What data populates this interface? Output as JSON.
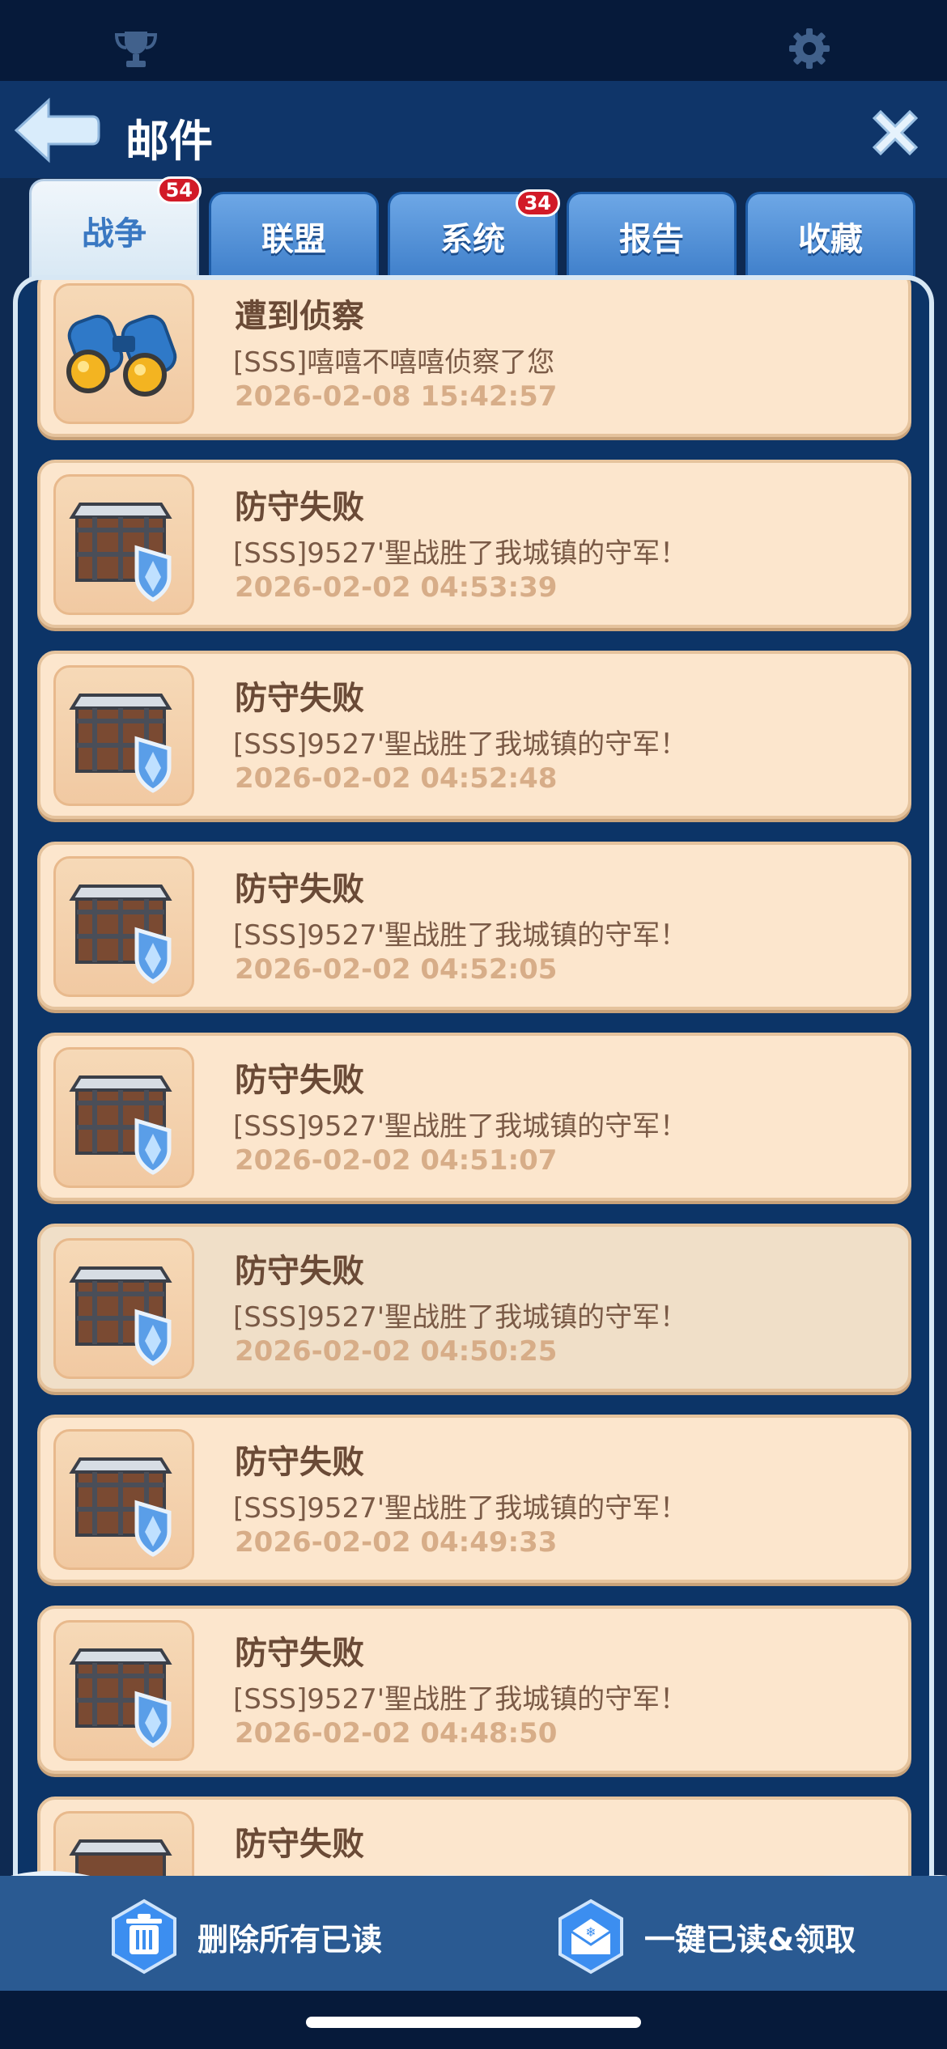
{
  "header": {
    "title": "邮件"
  },
  "tabs": [
    {
      "label": "战争",
      "badge": "54",
      "active": true
    },
    {
      "label": "联盟",
      "badge": "",
      "active": false
    },
    {
      "label": "系统",
      "badge": "34",
      "active": false
    },
    {
      "label": "报告",
      "badge": "",
      "active": false
    },
    {
      "label": "收藏",
      "badge": "",
      "active": false
    }
  ],
  "mails": [
    {
      "subject": "遭到侦察",
      "body": "[SSS]嘻嘻不嘻嘻侦察了您",
      "time": "2026-02-08 15:42:57",
      "icon": "binoculars-icon"
    },
    {
      "subject": "防守失败",
      "body": "[SSS]9527'聖战胜了我城镇的守军！",
      "time": "2026-02-02 04:53:39",
      "icon": "fortress-shield-icon"
    },
    {
      "subject": "防守失败",
      "body": "[SSS]9527'聖战胜了我城镇的守军！",
      "time": "2026-02-02 04:52:48",
      "icon": "fortress-shield-icon"
    },
    {
      "subject": "防守失败",
      "body": "[SSS]9527'聖战胜了我城镇的守军！",
      "time": "2026-02-02 04:52:05",
      "icon": "fortress-shield-icon"
    },
    {
      "subject": "防守失败",
      "body": "[SSS]9527'聖战胜了我城镇的守军！",
      "time": "2026-02-02 04:51:07",
      "icon": "fortress-shield-icon"
    },
    {
      "subject": "防守失败",
      "body": "[SSS]9527'聖战胜了我城镇的守军！",
      "time": "2026-02-02 04:50:25",
      "icon": "fortress-shield-icon"
    },
    {
      "subject": "防守失败",
      "body": "[SSS]9527'聖战胜了我城镇的守军！",
      "time": "2026-02-02 04:49:33",
      "icon": "fortress-shield-icon"
    },
    {
      "subject": "防守失败",
      "body": "[SSS]9527'聖战胜了我城镇的守军！",
      "time": "2026-02-02 04:48:50",
      "icon": "fortress-shield-icon"
    },
    {
      "subject": "防守失败",
      "body": "",
      "time": "",
      "icon": "fortress-shield-icon"
    }
  ],
  "footer": {
    "delete_label": "删除所有已读",
    "read_all_label": "一键已读&领取"
  },
  "icons": {
    "top_left": "trophy-icon",
    "top_right": "gear-icon",
    "back": "back-arrow-icon",
    "close": "close-icon",
    "delete": "trash-icon",
    "read_all": "envelope-icon"
  },
  "colors": {
    "header_bg": "#0f3569",
    "card_bg": "#fce6cd",
    "badge": "#d21a27",
    "tab_active_text": "#3a78c2"
  }
}
